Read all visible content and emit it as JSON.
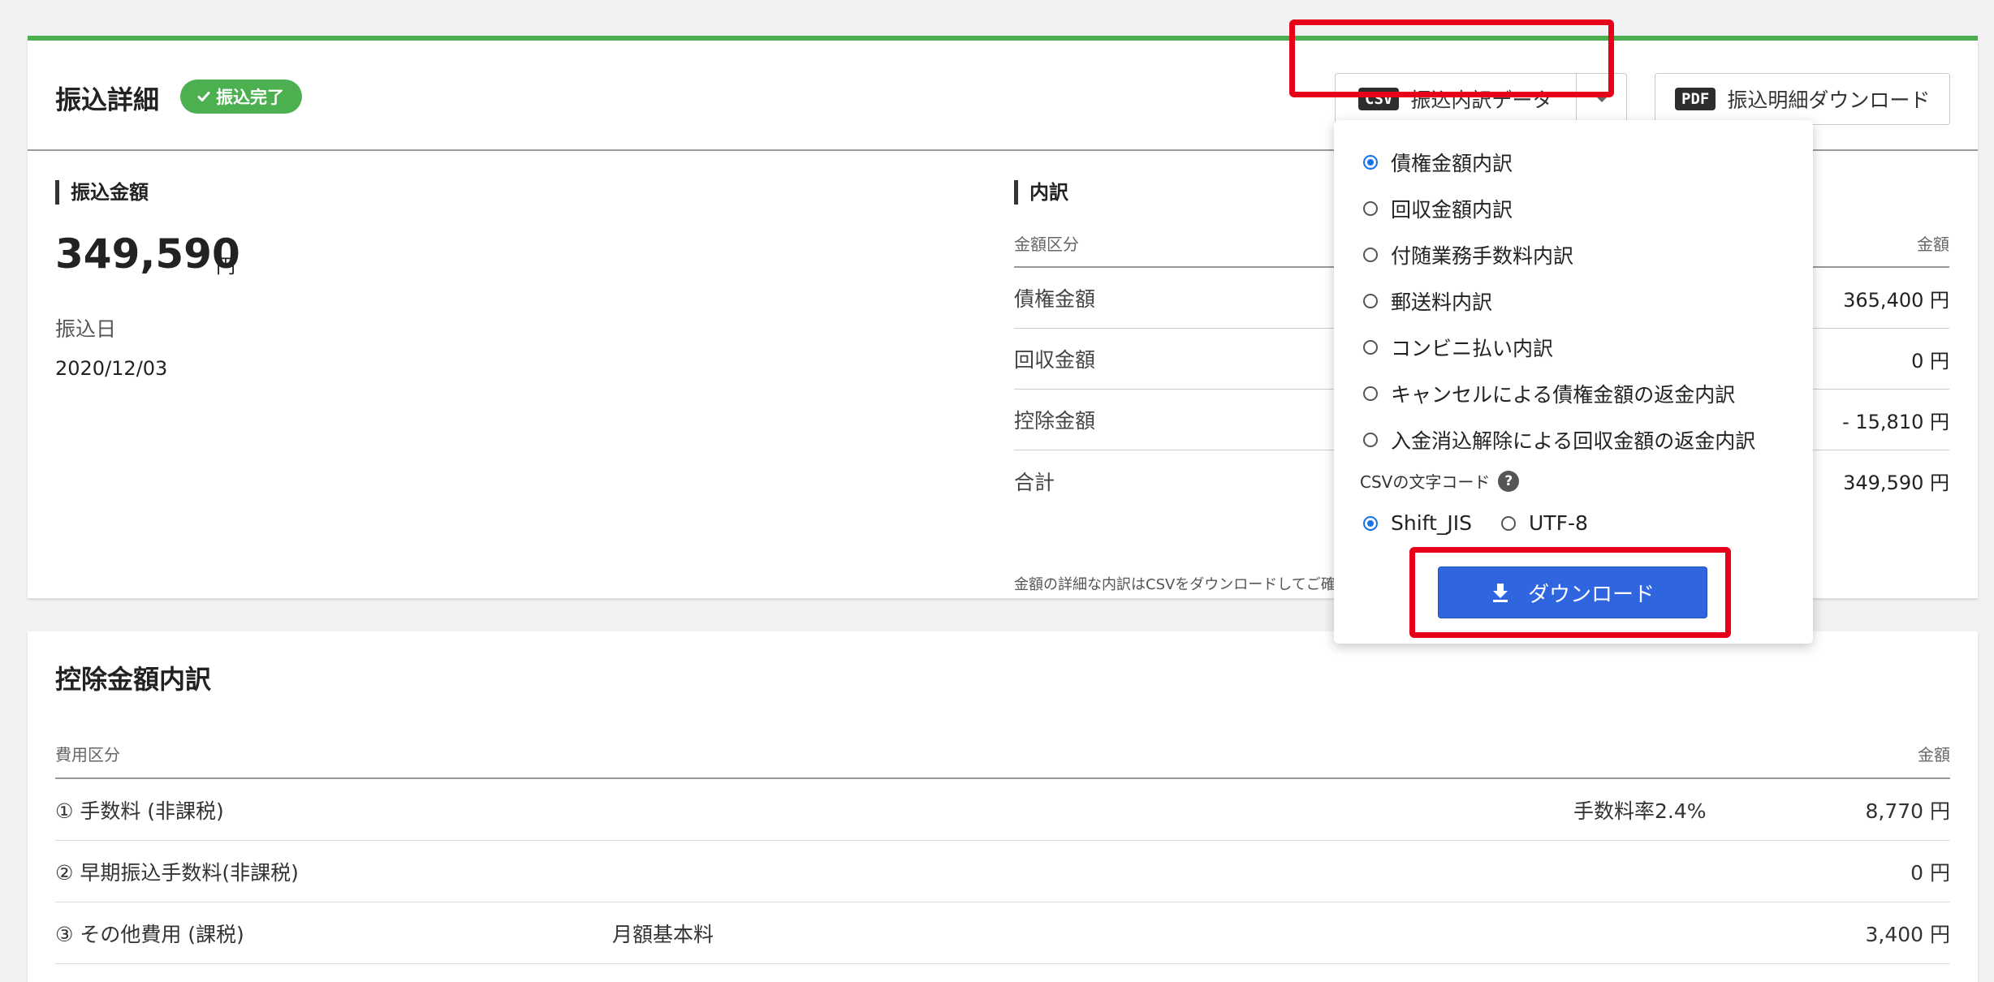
{
  "header": {
    "title": "振込詳細",
    "status_badge": "振込完了",
    "csv_chip": "CSV",
    "csv_button_label": "振込内訳データ",
    "pdf_chip": "PDF",
    "pdf_button_label": "振込明細ダウンロード"
  },
  "transfer": {
    "section_title": "振込金額",
    "amount": "349,590",
    "unit": "円",
    "date_label": "振込日",
    "date": "2020/12/03"
  },
  "breakdown": {
    "section_title": "内訳",
    "col_category": "金額区分",
    "col_amount": "金額",
    "rows": [
      {
        "label": "債権金額",
        "value": "365,400 円"
      },
      {
        "label": "回収金額",
        "value": "0 円"
      },
      {
        "label": "控除金額",
        "value": "- 15,810 円"
      },
      {
        "label": "合計",
        "value": "349,590 円"
      }
    ],
    "note": "金額の詳細な内訳はCSVをダウンロードしてご確認"
  },
  "dropdown": {
    "options": [
      {
        "label": "債権金額内訳",
        "selected": true
      },
      {
        "label": "回収金額内訳",
        "selected": false
      },
      {
        "label": "付随業務手数料内訳",
        "selected": false
      },
      {
        "label": "郵送料内訳",
        "selected": false
      },
      {
        "label": "コンビニ払い内訳",
        "selected": false
      },
      {
        "label": "キャンセルによる債権金額の返金内訳",
        "selected": false
      },
      {
        "label": "入金消込解除による回収金額の返金内訳",
        "selected": false
      }
    ],
    "encoding_label": "CSVの文字コード",
    "encodings": [
      {
        "label": "Shift_JIS",
        "selected": true
      },
      {
        "label": "UTF-8",
        "selected": false
      }
    ],
    "download_label": "ダウンロード"
  },
  "deductions": {
    "title": "控除金額内訳",
    "col_category": "費用区分",
    "col_amount": "金額",
    "rows": [
      {
        "label": "① 手数料 (非課税)",
        "detail": "",
        "rate": "手数料率2.4%",
        "value": "8,770 円"
      },
      {
        "label": "② 早期振込手数料(非課税)",
        "detail": "",
        "rate": "",
        "value": "0 円"
      },
      {
        "label": "③ その他費用 (課税)",
        "detail": "月額基本料",
        "rate": "",
        "value": "3,400 円"
      }
    ]
  },
  "colors": {
    "accent_green": "#4caf50",
    "primary_blue": "#2f66e0",
    "highlight_red": "#e6001a"
  }
}
